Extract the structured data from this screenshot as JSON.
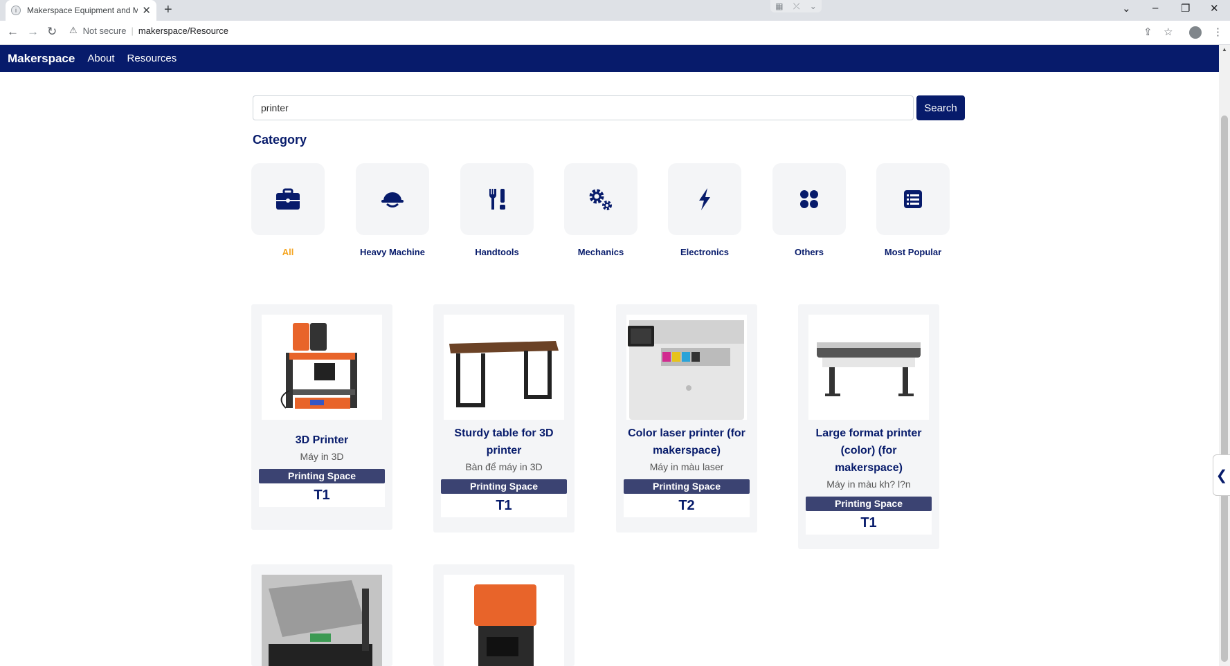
{
  "browser": {
    "tab_title": "Makerspace Equipment and Mat",
    "tab_favicon": "i",
    "not_secure": "Not secure",
    "url": "makerspace/Resource"
  },
  "site": {
    "brand": "Makerspace",
    "nav": [
      "About",
      "Resources"
    ]
  },
  "search": {
    "value": "printer",
    "button": "Search"
  },
  "category_heading": "Category",
  "categories": [
    {
      "label": "All",
      "icon": "toolbox-icon",
      "active": true
    },
    {
      "label": "Heavy Machine",
      "icon": "hard-hat-icon",
      "active": false
    },
    {
      "label": "Handtools",
      "icon": "tools-icon",
      "active": false
    },
    {
      "label": "Mechanics",
      "icon": "gears-icon",
      "active": false
    },
    {
      "label": "Electronics",
      "icon": "bolt-icon",
      "active": false
    },
    {
      "label": "Others",
      "icon": "dots-icon",
      "active": false
    },
    {
      "label": "Most Popular",
      "icon": "list-icon",
      "active": false
    }
  ],
  "products": [
    {
      "title": "3D Printer",
      "subtitle": "Máy in 3D",
      "badge": "Printing Space",
      "code": "T1",
      "image": "3d-printer-image"
    },
    {
      "title": "Sturdy table for 3D printer",
      "subtitle": "Bàn để máy in 3D",
      "badge": "Printing Space",
      "code": "T1",
      "image": "table-image"
    },
    {
      "title": "Color laser printer (for makerspace)",
      "subtitle": "Máy in màu laser",
      "badge": "Printing Space",
      "code": "T2",
      "image": "laser-printer-image"
    },
    {
      "title": "Large format printer (color) (for makerspace)",
      "subtitle": "Máy in màu kh? l?n",
      "badge": "Printing Space",
      "code": "T1",
      "image": "large-format-printer-image"
    },
    {
      "title": "",
      "subtitle": "",
      "badge": "",
      "code": "",
      "image": "screen-printing-press-image"
    },
    {
      "title": "",
      "subtitle": "",
      "badge": "",
      "code": "",
      "image": "resin-printer-image"
    }
  ],
  "colors": {
    "brand_navy": "#071b6b",
    "badge": "#3b4372",
    "active_category": "#f5a623",
    "card_bg": "#f4f5f7"
  }
}
